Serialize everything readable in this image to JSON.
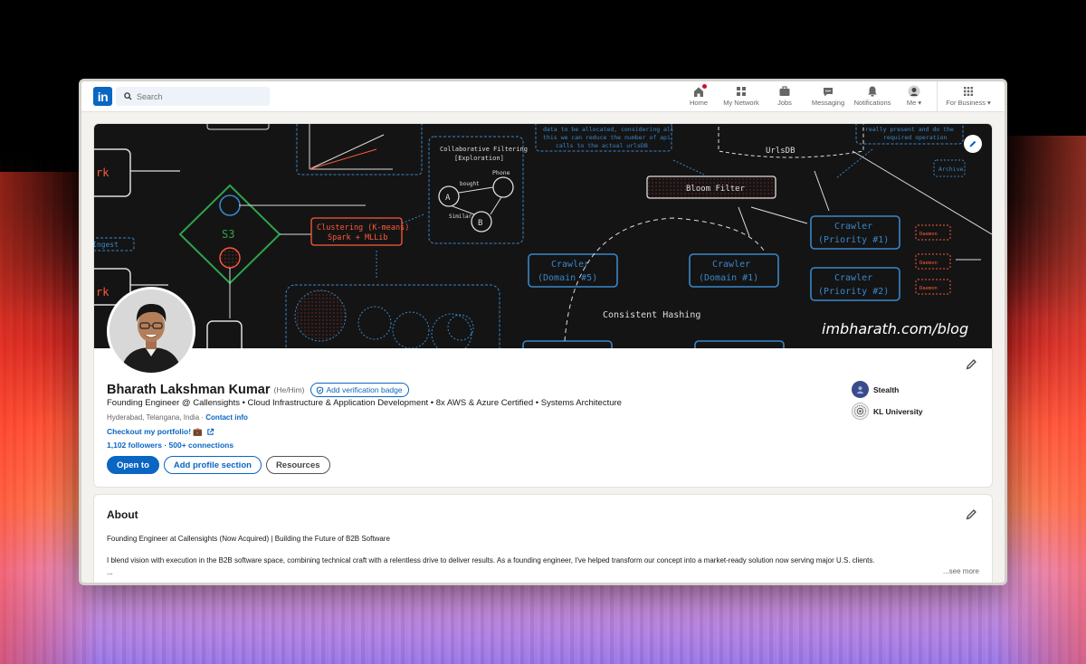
{
  "nav": {
    "logo": "in",
    "search_placeholder": "Search",
    "items": [
      {
        "label": "Home",
        "icon": "home-icon"
      },
      {
        "label": "My Network",
        "icon": "network-icon"
      },
      {
        "label": "Jobs",
        "icon": "briefcase-icon"
      },
      {
        "label": "Messaging",
        "icon": "message-icon"
      },
      {
        "label": "Notifications",
        "icon": "bell-icon"
      },
      {
        "label": "Me ▾",
        "icon": "avatar-icon"
      },
      {
        "label": "For Business ▾",
        "icon": "grid-icon"
      }
    ]
  },
  "banner": {
    "labels": [
      "Collaborative Filtering [Exploration]",
      "Bloom Filter",
      "UrlsDB",
      "Clustering (K-means) Spark + MLLib",
      "S3",
      "Crawler (Domain #5)",
      "Crawler (Domain #1)",
      "Crawler (Priority #1)",
      "Crawler (Priority #2)",
      "Consistent Hashing",
      "Archive",
      "Phone",
      "bought",
      "Similar",
      "Daemon",
      "Ingest"
    ],
    "note1": "data to be allocated, considering all this we can reduce the number of api calls to the actual urlsDB",
    "note2": "really present and do the required operation",
    "url": "imbharath.com/blog"
  },
  "profile": {
    "name": "Bharath Lakshman Kumar",
    "pronouns": "(He/Him)",
    "verify_label": "Add verification badge",
    "headline": "Founding Engineer @ Callensights • Cloud Infrastructure & Application Development • 8x AWS & Azure Certified • Systems Architecture",
    "location": "Hyderabad, Telangana, India",
    "contact": "Contact info",
    "portfolio": "Checkout my portfolio! 💼",
    "followers": "1,102 followers",
    "connections": "500+ connections",
    "buttons": {
      "open_to": "Open to",
      "add_section": "Add profile section",
      "resources": "Resources"
    },
    "experience": [
      {
        "name": "Stealth",
        "color": "#3b4a8a"
      },
      {
        "name": "KL University",
        "color": "#f2f2f2"
      }
    ]
  },
  "about": {
    "title": "About",
    "line1": "Founding Engineer at Callensights (Now Acquired) | Building the Future of B2B Software",
    "line2": "I blend vision with execution in the B2B software space, combining technical craft with a relentless drive to deliver results. As a founding engineer, I've helped transform our concept into a market-ready solution now serving major U.S. clients.",
    "ellipsis": "...",
    "see_more": "...see more"
  }
}
